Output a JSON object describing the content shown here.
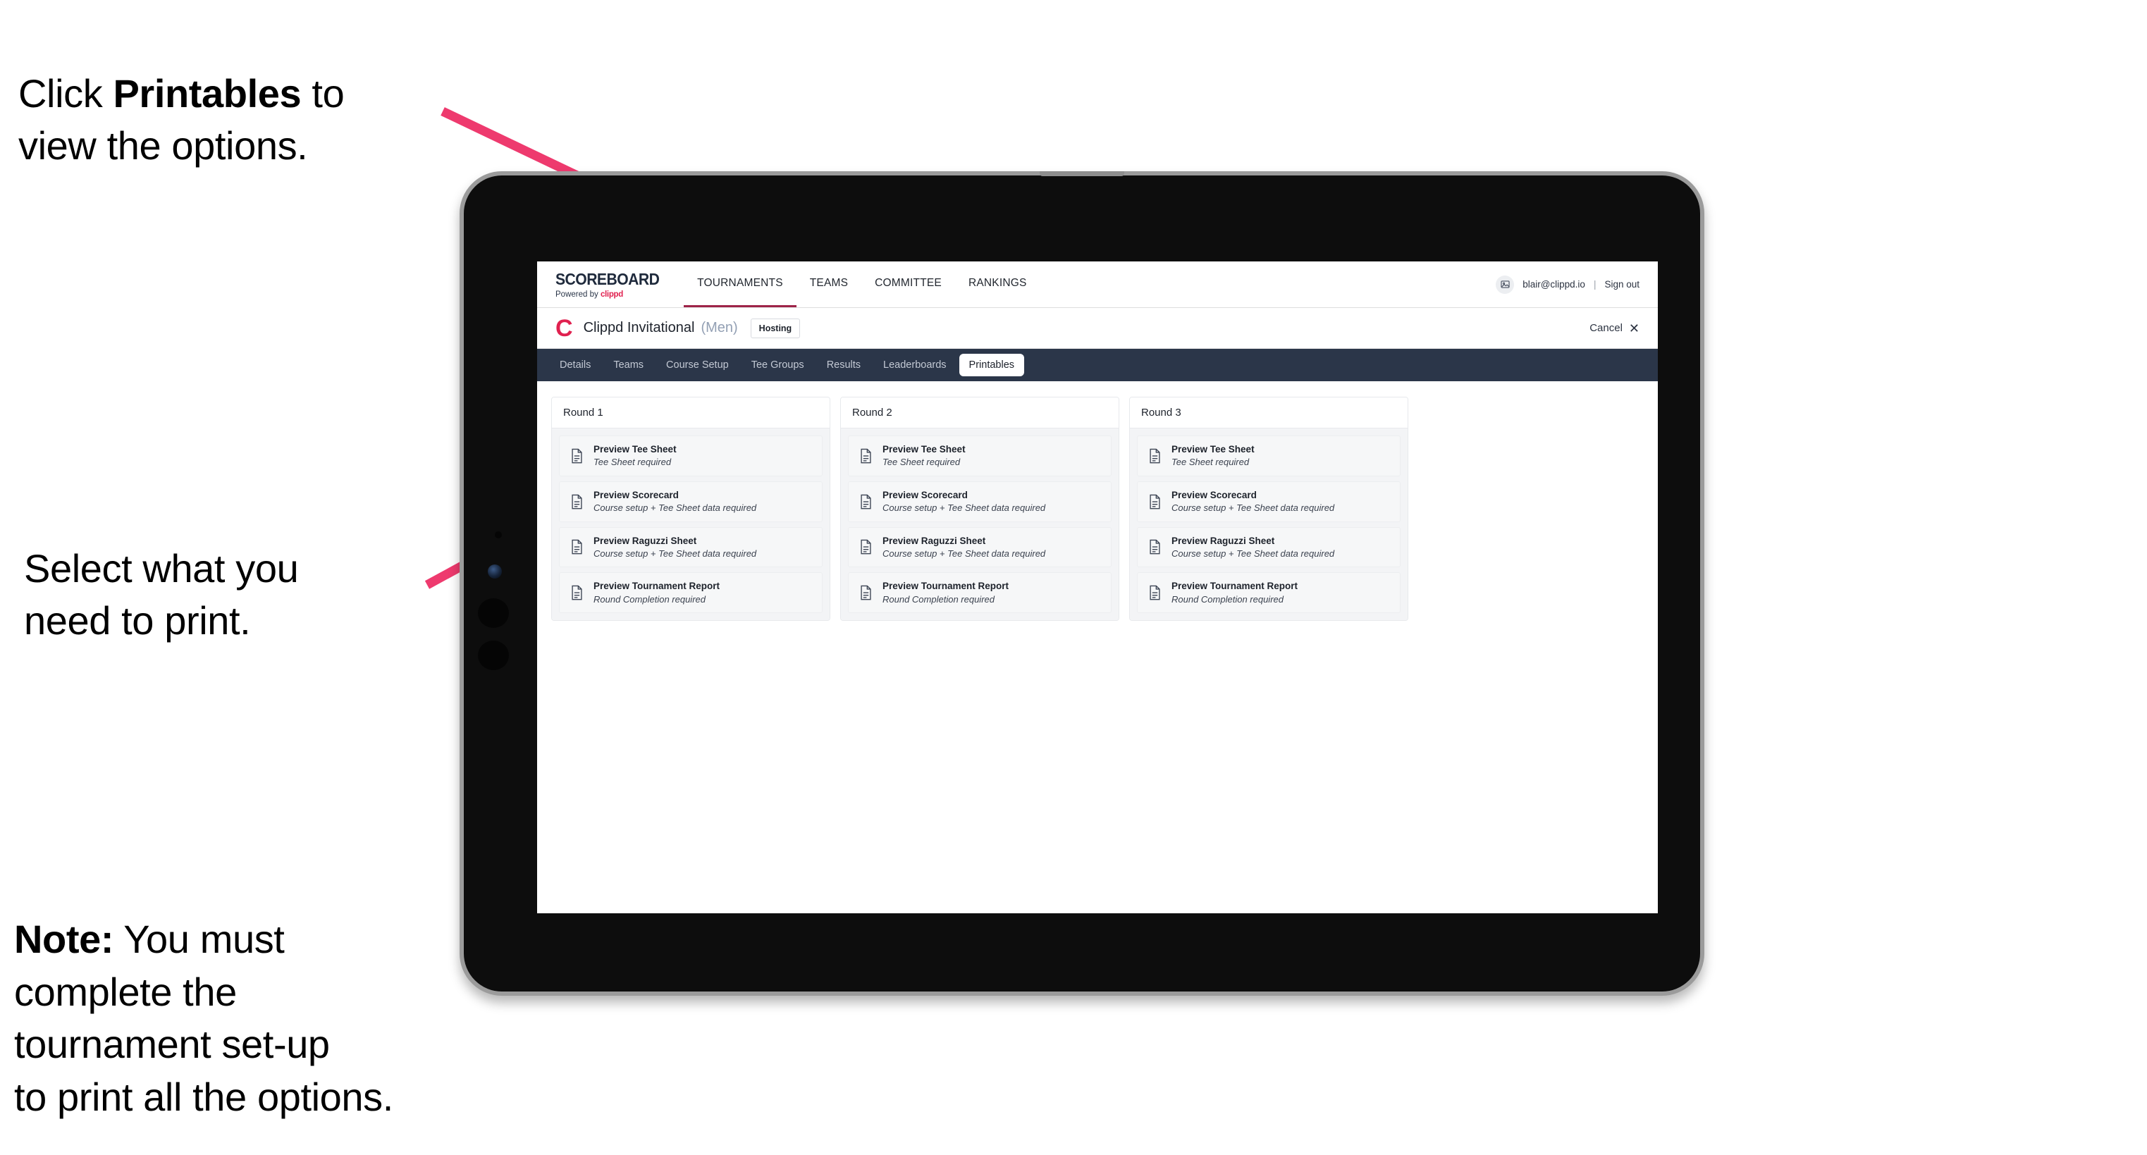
{
  "annotations": {
    "click_printables": {
      "prefix": "Click ",
      "bold": "Printables",
      "suffix": " to\nview the options."
    },
    "select_print": "Select what you\n need to print.",
    "note": {
      "bold": "Note:",
      "text": " You must\ncomplete the\ntournament set-up\nto print all the options."
    }
  },
  "colors": {
    "accent_pink": "#ee3a6e",
    "brand_crimson": "#e0214f",
    "subnav_dark": "#2b3649",
    "active_underline": "#9e2348"
  },
  "app": {
    "brand": {
      "title": "SCOREBOARD",
      "powered_prefix": "Powered by ",
      "powered_name": "clippd"
    },
    "top_nav": [
      {
        "label": "TOURNAMENTS",
        "active": true
      },
      {
        "label": "TEAMS",
        "active": false
      },
      {
        "label": "COMMITTEE",
        "active": false
      },
      {
        "label": "RANKINGS",
        "active": false
      }
    ],
    "account": {
      "avatar_icon": "user-image-icon",
      "email": "blair@clippd.io",
      "divider": "|",
      "sign_out": "Sign out"
    },
    "title_bar": {
      "logo_letter": "C",
      "tournament_name": "Clippd Invitational",
      "gender": "(Men)",
      "hosting_badge": "Hosting",
      "cancel_label": "Cancel",
      "cancel_icon": "close-x-icon"
    },
    "sub_nav": [
      {
        "label": "Details",
        "active": false
      },
      {
        "label": "Teams",
        "active": false
      },
      {
        "label": "Course Setup",
        "active": false
      },
      {
        "label": "Tee Groups",
        "active": false
      },
      {
        "label": "Results",
        "active": false
      },
      {
        "label": "Leaderboards",
        "active": false
      },
      {
        "label": "Printables",
        "active": true
      }
    ],
    "rounds": [
      {
        "header": "Round 1",
        "items": [
          {
            "icon": "document-icon",
            "title": "Preview Tee Sheet",
            "subtitle": "Tee Sheet required"
          },
          {
            "icon": "document-icon",
            "title": "Preview Scorecard",
            "subtitle": "Course setup + Tee Sheet data required"
          },
          {
            "icon": "document-icon",
            "title": "Preview Raguzzi Sheet",
            "subtitle": "Course setup + Tee Sheet data required"
          },
          {
            "icon": "document-icon",
            "title": "Preview Tournament Report",
            "subtitle": "Round Completion required"
          }
        ]
      },
      {
        "header": "Round 2",
        "items": [
          {
            "icon": "document-icon",
            "title": "Preview Tee Sheet",
            "subtitle": "Tee Sheet required"
          },
          {
            "icon": "document-icon",
            "title": "Preview Scorecard",
            "subtitle": "Course setup + Tee Sheet data required"
          },
          {
            "icon": "document-icon",
            "title": "Preview Raguzzi Sheet",
            "subtitle": "Course setup + Tee Sheet data required"
          },
          {
            "icon": "document-icon",
            "title": "Preview Tournament Report",
            "subtitle": "Round Completion required"
          }
        ]
      },
      {
        "header": "Round 3",
        "items": [
          {
            "icon": "document-icon",
            "title": "Preview Tee Sheet",
            "subtitle": "Tee Sheet required"
          },
          {
            "icon": "document-icon",
            "title": "Preview Scorecard",
            "subtitle": "Course setup + Tee Sheet data required"
          },
          {
            "icon": "document-icon",
            "title": "Preview Raguzzi Sheet",
            "subtitle": "Course setup + Tee Sheet data required"
          },
          {
            "icon": "document-icon",
            "title": "Preview Tournament Report",
            "subtitle": "Round Completion required"
          }
        ]
      }
    ]
  }
}
